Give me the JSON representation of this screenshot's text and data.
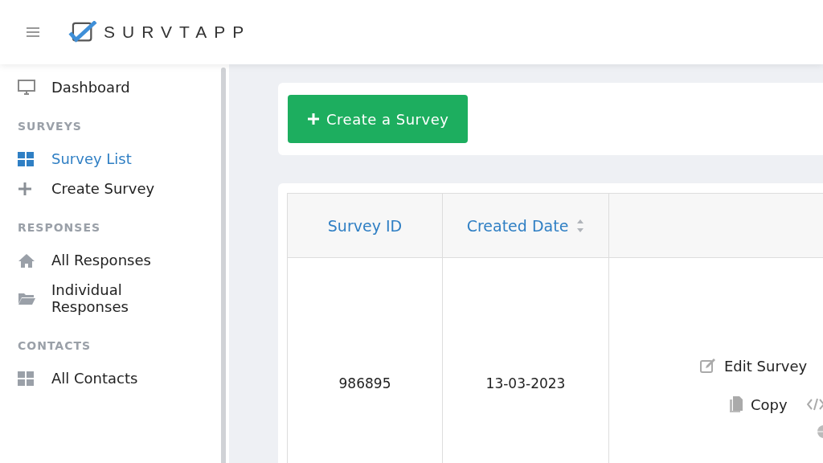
{
  "header": {
    "logo_text": "SURVTAPP"
  },
  "sidebar": {
    "sections": [
      {
        "items": [
          {
            "label": "Dashboard",
            "selected": false
          }
        ]
      },
      {
        "heading": "SURVEYS",
        "items": [
          {
            "label": "Survey List",
            "selected": true
          },
          {
            "label": "Create Survey",
            "selected": false
          }
        ]
      },
      {
        "heading": "RESPONSES",
        "items": [
          {
            "label": "All Responses",
            "selected": false
          },
          {
            "label": "Individual Responses",
            "selected": false
          }
        ]
      },
      {
        "heading": "CONTACTS",
        "items": [
          {
            "label": "All Contacts",
            "selected": false
          }
        ]
      }
    ]
  },
  "create_button": "Create a Survey",
  "table": {
    "columns": [
      "Survey ID",
      "Created Date"
    ],
    "rows": [
      {
        "cells": [
          "986895",
          "13-03-2023"
        ],
        "actions": [
          "Edit Survey",
          "Copy"
        ]
      }
    ]
  }
}
